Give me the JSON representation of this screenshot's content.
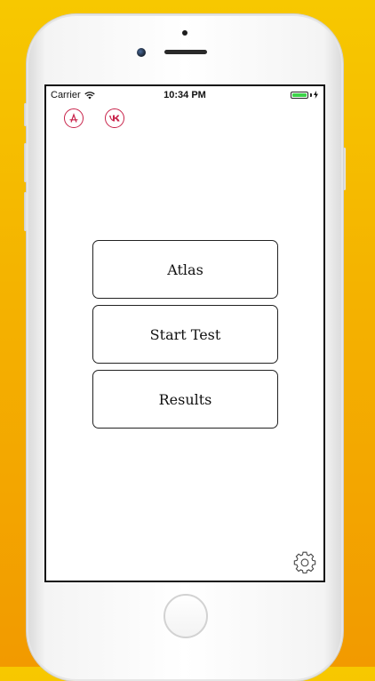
{
  "status_bar": {
    "carrier": "Carrier",
    "time": "10:34 PM",
    "battery_level": 1.0
  },
  "top_icons": [
    {
      "name": "appstore-icon"
    },
    {
      "name": "vk-icon"
    }
  ],
  "menu": {
    "atlas_label": "Atlas",
    "start_test_label": "Start Test",
    "results_label": "Results"
  },
  "colors": {
    "background_top": "#f7c800",
    "background_bottom": "#f29a00",
    "icon_accent": "#c8234a",
    "battery_fill": "#3dd44a"
  }
}
